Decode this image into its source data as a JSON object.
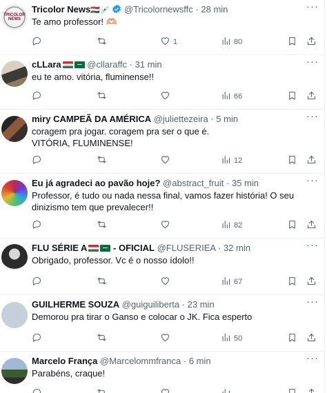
{
  "tweets": [
    {
      "name": "Tricolor News",
      "extra": "🇭🇺💉",
      "verified": true,
      "handle": "@Tricolornewsffc",
      "time": "28 min",
      "text": "Te amo professor! 🫶🏼",
      "replies": "",
      "retweets": "",
      "likes": "1",
      "views": "80",
      "avatar_text": "TRICOLOR NEWS"
    },
    {
      "name": "cLLara",
      "flags": [
        "hu",
        "sa"
      ],
      "handle": "@cllaraffc",
      "time": "31 min",
      "text": "eu te amo. vitória, fluminense!!",
      "replies": "",
      "retweets": "",
      "likes": "",
      "views": "66"
    },
    {
      "name": "miry CAMPEÃ DA AMÉRICA",
      "handle": "@juliettezeira",
      "time": "5 min",
      "text": "coragem pra jogar. coragem pra ser o que é.\nVITÓRIA, FLUMINENSE!",
      "replies": "",
      "retweets": "",
      "likes": "",
      "views": "12"
    },
    {
      "name": "Eu já agradeci ao pavão hoje?",
      "handle": "@abstract_fruit",
      "time": "35 min",
      "text": "Professor, é tudo ou nada nessa final, vamos fazer história! O seu dinizismo tem que prevalecer!!",
      "replies": "",
      "retweets": "",
      "likes": "",
      "views": "82"
    },
    {
      "name": "FLU SÉRIE A",
      "flags": [
        "hu",
        "sa"
      ],
      "name_suffix": "- OFICIAL",
      "handle": "@FLUSERIEA",
      "time": "32 min",
      "text": "Obrigado, professor.  Vc é o nosso ídolo!!",
      "replies": "",
      "retweets": "",
      "likes": "",
      "views": "67"
    },
    {
      "name": "GUILHERME SOUZA",
      "handle": "@guiguiliberta",
      "time": "23 min",
      "text": "Demorou pra tirar o Ganso e colocar o JK. Fica esperto",
      "replies": "",
      "retweets": "",
      "likes": "",
      "views": "50"
    },
    {
      "name": "Marcelo França",
      "handle": "@Marcelommfranca",
      "time": "6 min",
      "text": "Parabéns, craque!",
      "replies": "",
      "retweets": "",
      "likes": "",
      "views": ""
    }
  ],
  "icons": {
    "reply": "reply-icon",
    "retweet": "retweet-icon",
    "like": "heart-icon",
    "views": "views-icon",
    "bookmark": "bookmark-icon",
    "share": "share-icon",
    "more": "more-icon"
  },
  "colors": {
    "text": "#0f1419",
    "muted": "#536471",
    "verified": "#1d9bf0",
    "border": "#eff3f4"
  },
  "more_label": "···",
  "dot": "·"
}
